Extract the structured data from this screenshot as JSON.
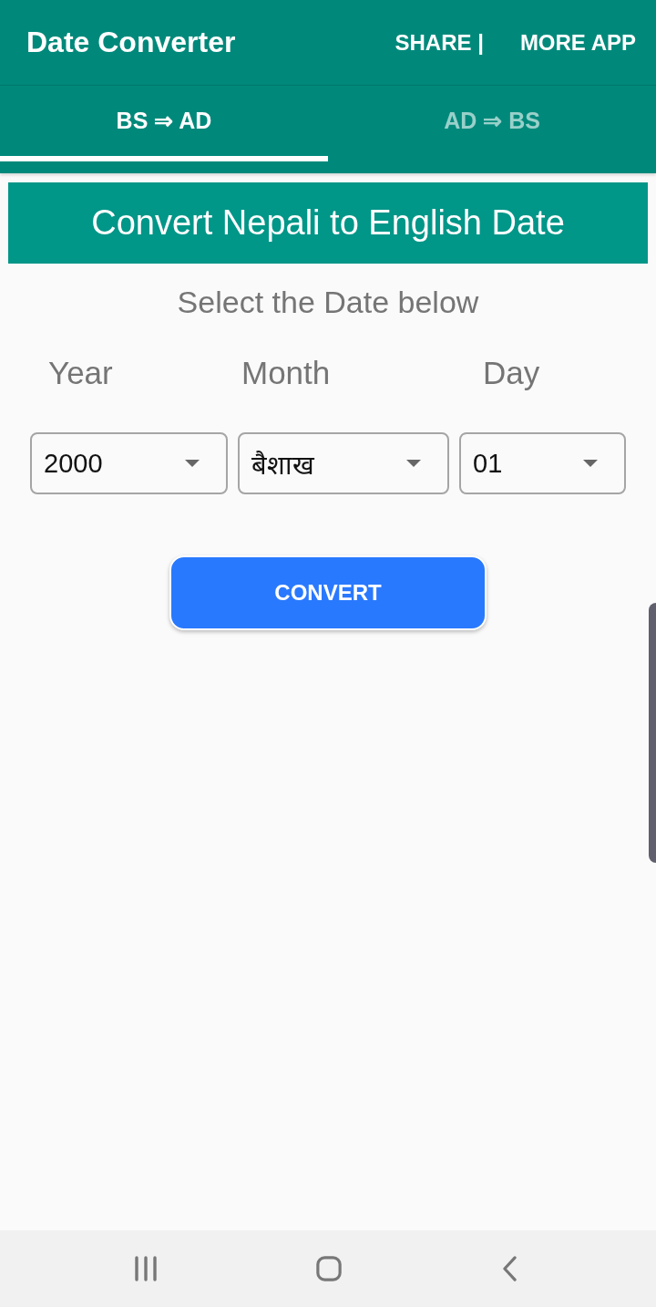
{
  "app_bar": {
    "title": "Date Converter",
    "actions": [
      "SHARE |",
      "MORE APP"
    ]
  },
  "tabs": [
    {
      "label": "BS ⇒ AD",
      "selected": true
    },
    {
      "label": "AD ⇒ BS",
      "selected": false
    }
  ],
  "heading": "Convert Nepali to English Date",
  "instruction": "Select the Date below",
  "pickers": [
    {
      "label": "Year",
      "value": "2000"
    },
    {
      "label": "Month",
      "value": "बैशाख"
    },
    {
      "label": "Day",
      "value": "01"
    }
  ],
  "button": "CONVERT"
}
